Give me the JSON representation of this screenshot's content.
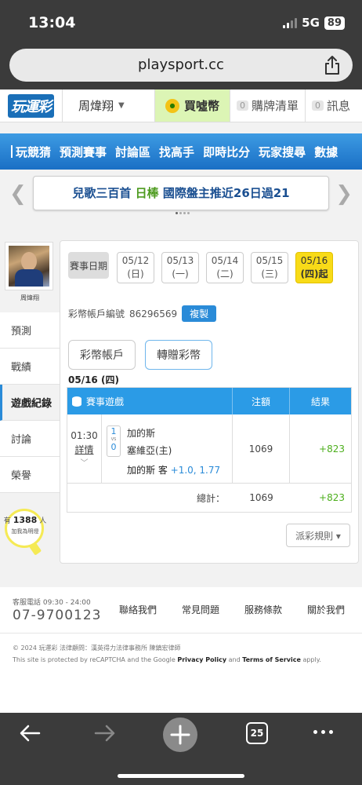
{
  "status_bar": {
    "time": "13:04",
    "network": "5G",
    "battery": "89"
  },
  "browser": {
    "url": "playsport.cc",
    "tab_count": "25"
  },
  "header": {
    "logo_text": "玩運彩",
    "user_name": "周煒翔",
    "buy_coin_label": "買噓幣",
    "cart_count": "0",
    "cart_label": "購牌清單",
    "msg_count": "0",
    "msg_label": "訊息"
  },
  "nav": {
    "items": [
      "玩競猜",
      "預測賽事",
      "討論區",
      "找高手",
      "即時比分",
      "玩家搜尋",
      "數據"
    ]
  },
  "banner": {
    "text_a": "兒歌三百首",
    "text_b": "日棒",
    "text_c": "國際盤主推近26日過21"
  },
  "sidebar": {
    "avatar_name": "周煒翔",
    "items": [
      "預測",
      "戰績",
      "遊戲紀錄",
      "討論",
      "榮譽"
    ],
    "like_prefix": "有",
    "like_count": "1388",
    "like_suffix": "人",
    "like_sub": "加我為明燈"
  },
  "main": {
    "date_label": "賽事日期",
    "dates": [
      {
        "date": "05/12",
        "weekday": "(日)"
      },
      {
        "date": "05/13",
        "weekday": "(一)"
      },
      {
        "date": "05/14",
        "weekday": "(二)"
      },
      {
        "date": "05/15",
        "weekday": "(三)"
      },
      {
        "date": "05/16",
        "weekday": "(四)",
        "suffix": "起"
      }
    ],
    "account_label": "彩幣帳戶編號",
    "account_number": "86296569",
    "copy_label": "複製",
    "btn_account": "彩幣帳戶",
    "btn_transfer": "轉贈彩幣",
    "date_heading": "05/16 (四)",
    "table": {
      "col_game": "賽事遊戲",
      "col_stake": "注額",
      "col_result": "結果",
      "row": {
        "time": "01:30",
        "detail": "詳情",
        "score_away": "1",
        "vs": "VS",
        "score_home": "0",
        "team_away": "加的斯",
        "team_home": "塞維亞(主)",
        "pick_team": "加的斯 客",
        "pick_line": "+1.0, 1.77",
        "stake": "1069",
        "result": "+823"
      },
      "total_label": "總計：",
      "total_stake": "1069",
      "total_result": "+823"
    },
    "rules_label": "派彩規則 ▾"
  },
  "footer": {
    "hotline_label": "客服電話 09:30 - 24:00",
    "hotline": "07-9700123",
    "links": [
      "聯絡我們",
      "常見問題",
      "服務條款",
      "關於我們"
    ],
    "copyright": "© 2024 玩運彩 法律顧問：漢英得力法律事務所 陳鎮宏律師",
    "recaptcha_a": "This site is protected by reCAPTCHA and the Google ",
    "privacy": "Privacy Policy",
    "recaptcha_and": " and ",
    "terms": "Terms of Service",
    "recaptcha_b": " apply."
  },
  "colors": {
    "nav_blue": "#2b8ae0",
    "table_head": "#2b9be6",
    "active_date": "#f8db18",
    "win_green": "#4caf1c",
    "buy_coin_bg": "#dcf5b5"
  }
}
